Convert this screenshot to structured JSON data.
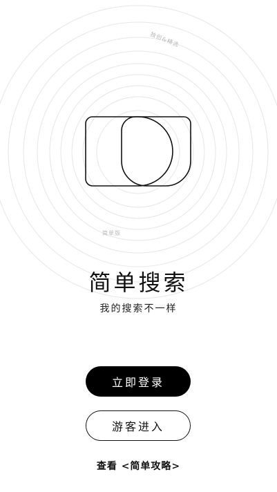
{
  "decor": {
    "ring_label_top": "独创&精选",
    "ring_label_bottom": "简单版"
  },
  "app": {
    "name": "简单搜索",
    "tagline": "我的搜索不一样"
  },
  "actions": {
    "login_label": "立即登录",
    "guest_label": "游客进入"
  },
  "guide": {
    "prefix": "查看",
    "link_label": "<简单攻略>"
  },
  "colors": {
    "primary": "#000000",
    "background": "#ffffff",
    "ring": "#e6e6e6"
  }
}
